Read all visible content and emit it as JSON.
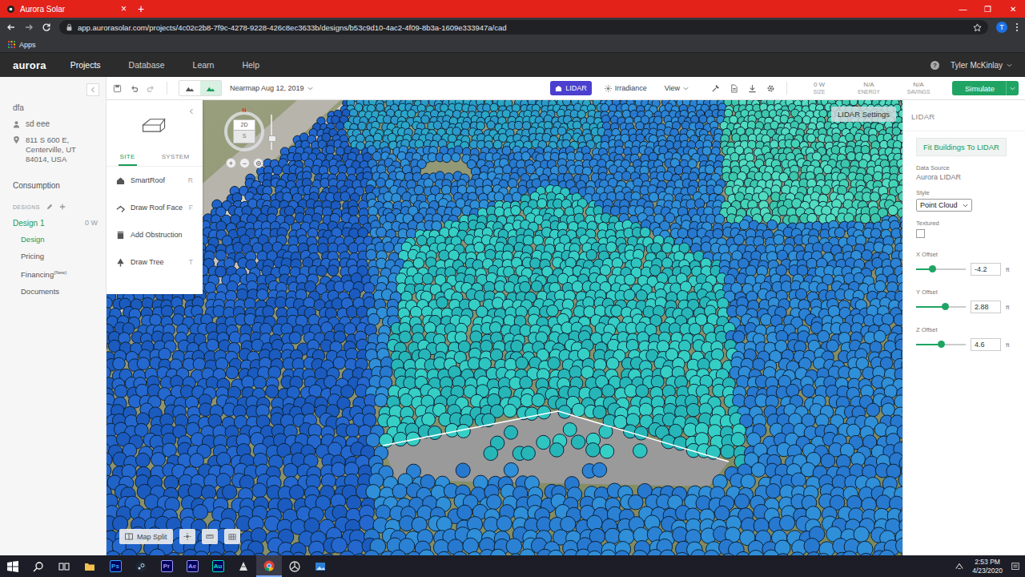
{
  "browser": {
    "tab": {
      "title": "Aurora Solar",
      "close": "×"
    },
    "new_tab": "+",
    "window_controls": [
      "—",
      "❐",
      "✕"
    ],
    "url": "app.aurorasolar.com/projects/4c02c2b8-7f9c-4278-9228-426c8ec3633b/designs/b53c9d10-4ac2-4f09-8b3a-1609e333947a/cad",
    "profile": "T",
    "bookmarks": [
      "Apps"
    ]
  },
  "app": {
    "logo": "aurora",
    "nav": [
      {
        "label": "Projects",
        "selected": true
      },
      {
        "label": "Database",
        "selected": false
      },
      {
        "label": "Learn",
        "selected": false
      },
      {
        "label": "Help",
        "selected": false
      }
    ],
    "help": "?",
    "user": "Tyler McKinlay"
  },
  "project": {
    "name": "dfa",
    "customer": "sd eee",
    "address": "811 S 600 E, Centerville, UT 84014, USA",
    "consumption": "Consumption",
    "designs_label": "DESIGNS",
    "design": {
      "name": "Design 1",
      "size": "0 W"
    },
    "items": [
      {
        "label": "Design",
        "badge": "",
        "selected": true
      },
      {
        "label": "Pricing",
        "badge": "",
        "selected": false
      },
      {
        "label": "Financing",
        "badge": "(New)",
        "selected": false
      },
      {
        "label": "Documents",
        "badge": "",
        "selected": false
      }
    ]
  },
  "toolbar": {
    "view_modes": [
      {
        "selected": false
      },
      {
        "selected": true
      }
    ],
    "imagery": "Nearmap Aug 12, 2019",
    "buttons": [
      {
        "label": "LIDAR",
        "selected": true,
        "dropdown": false
      },
      {
        "label": "Irradiance",
        "selected": false,
        "dropdown": false
      },
      {
        "label": "View",
        "selected": false,
        "dropdown": true
      }
    ],
    "stats": [
      {
        "value": "0 W",
        "label": "SIZE"
      },
      {
        "value": "N/A",
        "label": "ENERGY"
      },
      {
        "value": "N/A",
        "label": "SAVINGS"
      }
    ],
    "simulate": "Simulate"
  },
  "site_panel": {
    "tabs": [
      {
        "label": "SITE",
        "selected": true
      },
      {
        "label": "SYSTEM",
        "selected": false
      }
    ],
    "tools": [
      {
        "label": "SmartRoof",
        "key": "R",
        "kind": "smartroof"
      },
      {
        "label": "Draw Roof Face",
        "key": "F",
        "kind": "roofface"
      },
      {
        "label": "Add Obstruction",
        "key": "",
        "kind": "obstruction"
      },
      {
        "label": "Draw Tree",
        "key": "T",
        "kind": "tree"
      }
    ]
  },
  "canvas": {
    "compass": {
      "north": "N",
      "mode": "2D",
      "face": "S",
      "zoom": [
        "+",
        "−"
      ]
    },
    "lidar_settings": "LIDAR Settings",
    "map_split": "Map Split"
  },
  "lidar_panel": {
    "title": "LIDAR",
    "fit": "Fit Buildings To LIDAR",
    "data_source_label": "Data Source",
    "data_source": "Aurora LIDAR",
    "style_label": "Style",
    "style": "Point Cloud",
    "textured_label": "Textured",
    "textured": false,
    "offsets": [
      {
        "label": "X Offset",
        "value": "-4.2",
        "unit": "ft",
        "level": 0.34
      },
      {
        "label": "Y Offset",
        "value": "2.88",
        "unit": "ft",
        "level": 0.59
      },
      {
        "label": "Z Offset",
        "value": "4.6",
        "unit": "ft",
        "level": 0.52
      }
    ]
  },
  "taskbar": {
    "apps": [
      {
        "kind": "start",
        "label": "",
        "color": "#ffffff",
        "active": false
      },
      {
        "kind": "search",
        "label": "",
        "color": "#ffffff",
        "active": false
      },
      {
        "kind": "taskview",
        "label": "",
        "color": "#ffffff",
        "active": false
      },
      {
        "kind": "explorer",
        "label": "",
        "color": "#f2c14e",
        "active": false
      },
      {
        "kind": "badge",
        "label": "Ps",
        "color": "#31a8ff",
        "active": false
      },
      {
        "kind": "steam",
        "label": "",
        "color": "#c7d5e0",
        "active": false
      },
      {
        "kind": "badge",
        "label": "Pr",
        "color": "#9999ff",
        "active": false
      },
      {
        "kind": "badge",
        "label": "Ae",
        "color": "#9999ff",
        "active": false
      },
      {
        "kind": "badge",
        "label": "Au",
        "color": "#00e4bb",
        "active": false
      },
      {
        "kind": "app",
        "label": "",
        "color": "#e0e0e0",
        "active": false
      },
      {
        "kind": "chrome",
        "label": "",
        "color": "#4285f4",
        "active": true
      },
      {
        "kind": "unity",
        "label": "",
        "color": "#dddddd",
        "active": false
      },
      {
        "kind": "photos",
        "label": "",
        "color": "#2d7fd3",
        "active": false
      }
    ],
    "time": "2:53 PM",
    "date": "4/23/2020"
  }
}
